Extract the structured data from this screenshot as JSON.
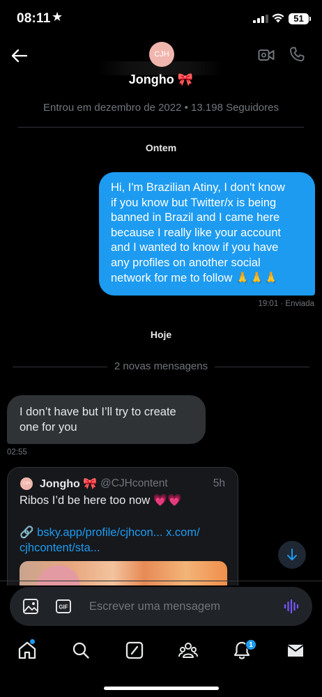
{
  "status_bar": {
    "time": "08:11",
    "battery": "51"
  },
  "header": {
    "avatar_initials": "CJH",
    "contact_name": "Jongho 🎀"
  },
  "thread": {
    "joined_info": "Entrou em dezembro de 2022 • 13.198 Seguidores",
    "day_yesterday": "Ontem",
    "outgoing_message": {
      "lines": [
        "Hi, I'm Brazilian Atiny, I don't know",
        "if you know but Twitter/x is being",
        "banned in Brazil and I came here",
        "because I really like your account",
        "and I wanted to know if you have",
        "any profiles on another social",
        "network for me to follow 🙏🙏🙏"
      ],
      "meta": "19:01 · Enviada"
    },
    "day_today": "Hoje",
    "new_messages_label": "2 novas mensagens",
    "incoming_message": {
      "lines": [
        "I don’t have but I’ll try to create",
        "one for you"
      ],
      "time": "02:55"
    },
    "shared_post": {
      "avatar_initials": "CJH",
      "author_name": "Jongho 🎀",
      "handle": "@CJHcontent",
      "time": "5h",
      "text": "Ribos I’d be here too now 💗💗",
      "link_line1": "bsky.app/profile/cjhcon... x.com/",
      "link_line2": "cjhcontent/sta...",
      "link_icon": "🔗"
    }
  },
  "composer": {
    "placeholder": "Escrever uma mensagem",
    "gif_label": "GIF"
  },
  "tabbar": {
    "notifications_badge": "1"
  },
  "colors": {
    "accent": "#1d9bf0",
    "bubble_in": "#2f3336",
    "muted": "#71767b",
    "voice": "#7856ff"
  }
}
